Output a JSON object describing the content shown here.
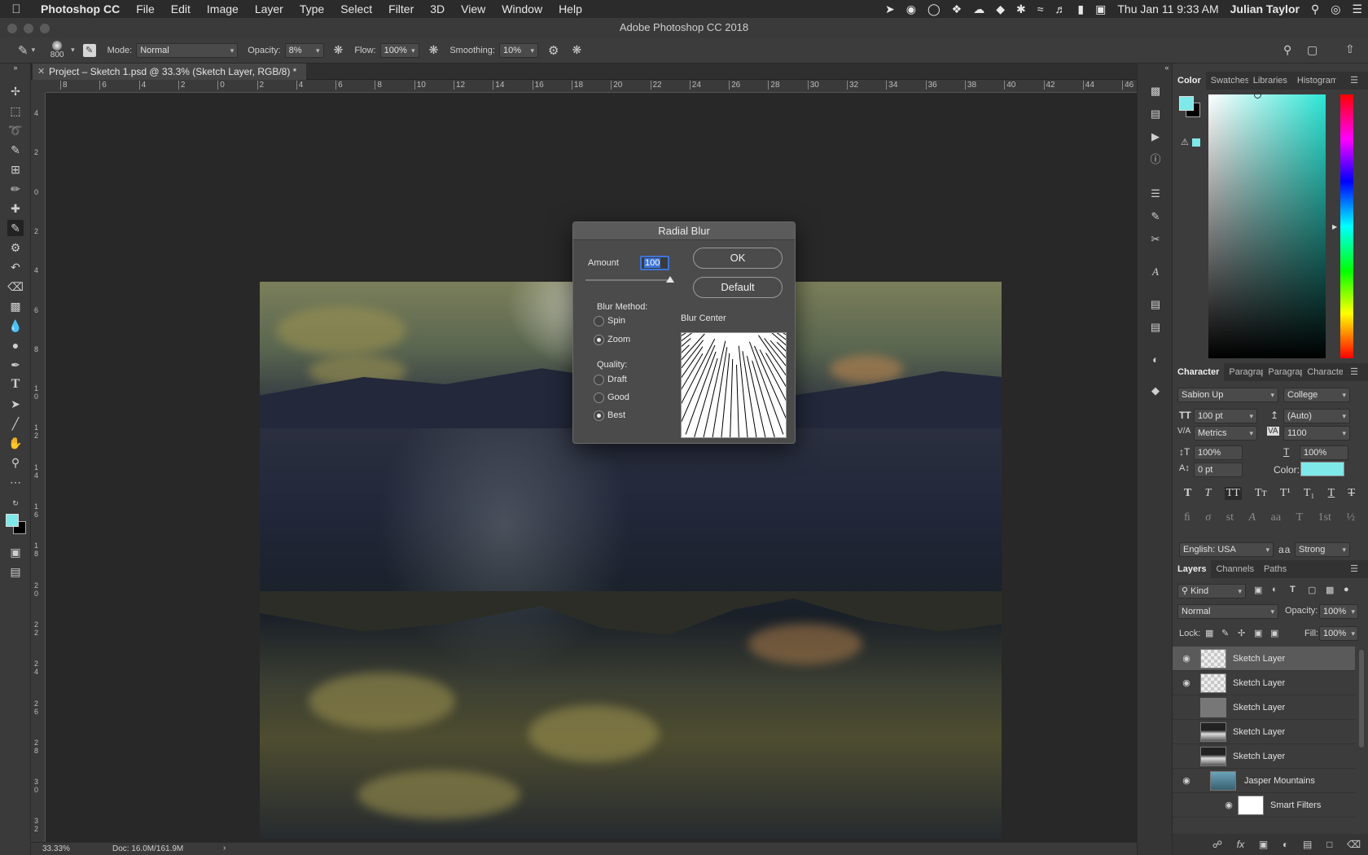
{
  "menubar": {
    "apple": "",
    "app": "Photoshop CC",
    "items": [
      "File",
      "Edit",
      "Image",
      "Layer",
      "Type",
      "Select",
      "Filter",
      "3D",
      "View",
      "Window",
      "Help"
    ],
    "clock": "Thu Jan 11  9:33 AM",
    "user": "Julian Taylor"
  },
  "window": {
    "title": "Adobe Photoshop CC 2018"
  },
  "options": {
    "brush_size": "800",
    "mode_label": "Mode:",
    "mode_value": "Normal",
    "opacity_label": "Opacity:",
    "opacity_value": "8%",
    "flow_label": "Flow:",
    "flow_value": "100%",
    "smoothing_label": "Smoothing:",
    "smoothing_value": "10%"
  },
  "doc": {
    "tab_title": "Project – Sketch 1.psd @ 33.3% (Sketch Layer, RGB/8) *"
  },
  "ruler": {
    "h_labels": [
      "8",
      "6",
      "4",
      "2",
      "0",
      "2",
      "4",
      "6",
      "8",
      "10",
      "12",
      "14",
      "16",
      "18",
      "20",
      "22",
      "24",
      "26",
      "28",
      "30",
      "32",
      "34",
      "36",
      "38",
      "40",
      "42",
      "44",
      "46"
    ],
    "v_labels": [
      "4",
      "2",
      "0",
      "2",
      "4",
      "6",
      "8",
      "1\n0",
      "1\n2",
      "1\n4",
      "1\n6",
      "1\n8",
      "2\n0",
      "2\n2",
      "2\n4",
      "2\n6",
      "2\n8",
      "3\n0",
      "3\n2"
    ]
  },
  "dialog": {
    "title": "Radial Blur",
    "amount_label": "Amount",
    "amount_value": "100",
    "amount_slider": 1.0,
    "ok_label": "OK",
    "default_label": "Default",
    "blur_method_label": "Blur Method:",
    "methods": [
      {
        "label": "Spin",
        "selected": false
      },
      {
        "label": "Zoom",
        "selected": true
      }
    ],
    "quality_label": "Quality:",
    "qualities": [
      {
        "label": "Draft",
        "selected": false
      },
      {
        "label": "Good",
        "selected": false
      },
      {
        "label": "Best",
        "selected": true
      }
    ],
    "blur_center_label": "Blur Center"
  },
  "color_panel": {
    "tabs": [
      "Color",
      "Swatches",
      "Libraries",
      "Histogram"
    ],
    "foreground": "#7fe8e8",
    "background": "#000000"
  },
  "character_panel": {
    "tabs": [
      "Character",
      "Paragraph",
      "Paragraph",
      "Character"
    ],
    "font_family": "Sabion Up",
    "font_style": "College",
    "font_size": "100 pt",
    "leading": "(Auto)",
    "kerning": "Metrics",
    "tracking": "1100",
    "vscale": "100%",
    "hscale": "100%",
    "baseline": "0 pt",
    "color_label": "Color:",
    "color": "#7fe8e8",
    "language": "English: USA",
    "aa_label": "a a",
    "antialias": "Strong"
  },
  "layers_panel": {
    "tabs": [
      "Layers",
      "Channels",
      "Paths"
    ],
    "filter_kind": "Kind",
    "blend_mode": "Normal",
    "opacity_label": "Opacity:",
    "opacity": "100%",
    "lock_label": "Lock:",
    "fill_label": "Fill:",
    "fill": "100%",
    "layers": [
      {
        "name": "Sketch Layer",
        "visible": true,
        "selected": true
      },
      {
        "name": "Sketch Layer",
        "visible": true,
        "selected": false
      },
      {
        "name": "Sketch Layer",
        "visible": false,
        "selected": false
      },
      {
        "name": "Sketch Layer",
        "visible": false,
        "selected": false
      },
      {
        "name": "Sketch Layer",
        "visible": false,
        "selected": false
      },
      {
        "name": "Jasper Mountains",
        "visible": true,
        "selected": false
      },
      {
        "name": "Smart Filters",
        "visible": true,
        "selected": false
      }
    ]
  },
  "status": {
    "zoom": "33.33%",
    "doc_size": "Doc: 16.0M/161.9M"
  }
}
